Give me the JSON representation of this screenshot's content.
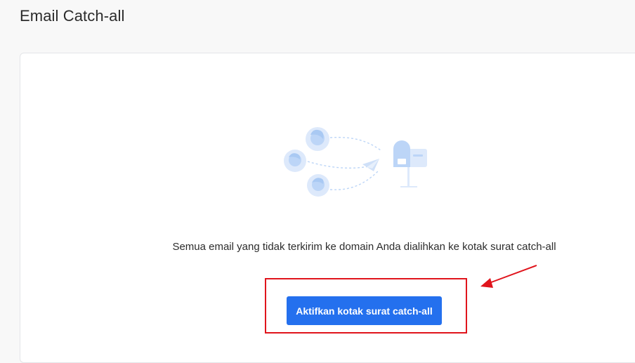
{
  "header": {
    "title": "Email Catch-all"
  },
  "main": {
    "illustration": {
      "icon_names": [
        "user-avatar-icon",
        "envelope-arrow-icon",
        "mailbox-icon"
      ]
    },
    "description": "Semua email yang tidak terkirim ke domain Anda dialihkan ke kotak surat catch-all",
    "activate_button_label": "Aktifkan kotak surat catch-all"
  },
  "annotation": {
    "highlight_color": "#e0141c",
    "arrow_color": "#e0141c"
  },
  "colors": {
    "accent": "#2470ee",
    "illustration": "#bcd5f7"
  }
}
